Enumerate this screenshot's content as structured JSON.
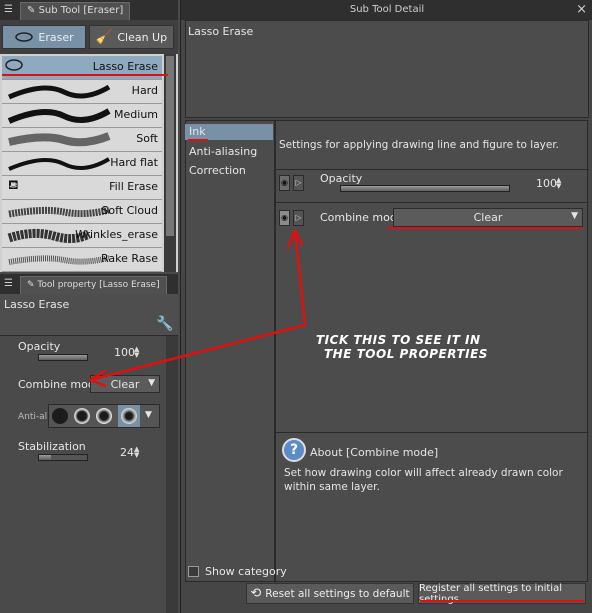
{
  "left_top": {
    "tab_label": "Sub Tool [Eraser]",
    "buttons": [
      {
        "label": "Eraser",
        "icon": "lasso-icon"
      },
      {
        "label": "Clean Up",
        "icon": "broom-icon"
      }
    ]
  },
  "brushes": [
    "Lasso Erase",
    "Hard",
    "Medium",
    "Soft",
    "Hard flat",
    "Fill Erase",
    "Soft Cloud",
    "Wrinkles_erase",
    "Rake Rase"
  ],
  "tool_property": {
    "tab_label": "Tool property [Lasso Erase]",
    "title": "Lasso Erase",
    "opacity_label": "Opacity",
    "opacity_value": "100",
    "opacity_fraction": 1.0,
    "combine_label": "Combine mode",
    "combine_value": "Clear",
    "antialias_label": "Anti-al",
    "stabilization_label": "Stabilization",
    "stabilization_value": "24",
    "stabilization_fraction": 0.24
  },
  "detail": {
    "title": "Sub Tool Detail",
    "close": "×",
    "preview_title": "Lasso Erase",
    "nav": [
      "Ink",
      "Anti-aliasing",
      "Correction"
    ],
    "heading": "Settings for applying drawing line and figure to layer.",
    "opacity_label": "Opacity",
    "opacity_value": "100",
    "opacity_fraction": 1.0,
    "combine_label": "Combine mode",
    "combine_value": "Clear",
    "about_title": "About [Combine mode]",
    "about_text": "Set how drawing color will affect already drawn color within same layer.",
    "show_category": "Show category",
    "reset_label": "Reset all settings to default",
    "register_label": "Register all settings to initial settings"
  },
  "annotation": {
    "line1": "TICK THIS TO SEE IT IN",
    "line2": "THE TOOL PROPERTIES"
  },
  "colors": {
    "accent": "#7891a6",
    "annotation": "#e01010"
  }
}
